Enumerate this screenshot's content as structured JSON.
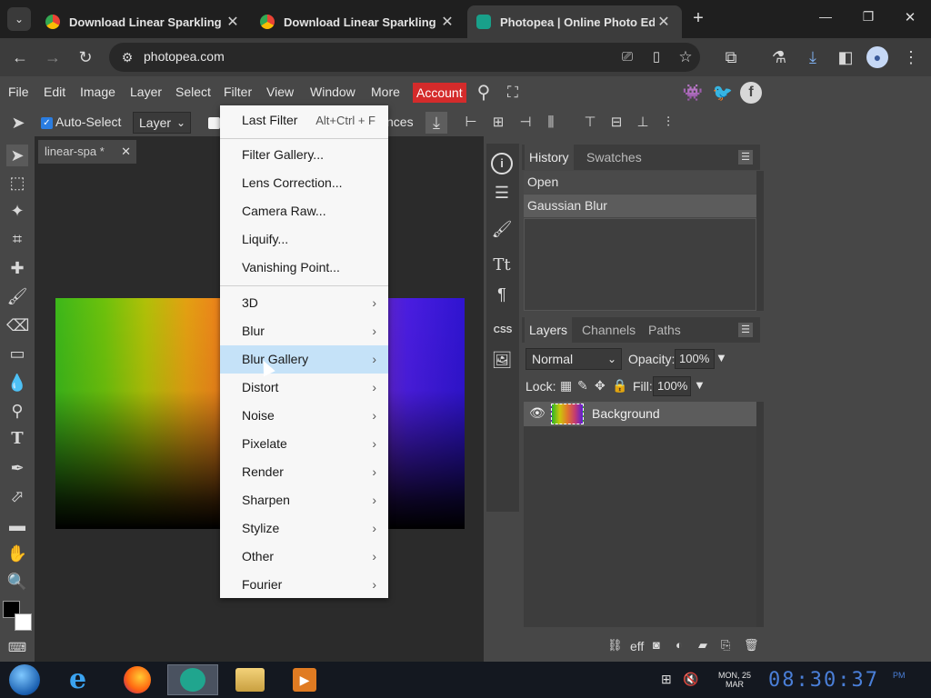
{
  "browser": {
    "tabs": [
      {
        "title": "Download Linear Sparkling Ra",
        "close": "✕"
      },
      {
        "title": "Download Linear Sparkling Ra",
        "close": "✕"
      },
      {
        "title": "Photopea | Online Photo Editor",
        "close": "✕"
      }
    ],
    "new_tab": "+",
    "url": "photopea.com",
    "window_buttons": [
      "—",
      "❐",
      "✕"
    ]
  },
  "menubar": {
    "items": [
      "File",
      "Edit",
      "Image",
      "Layer",
      "Select",
      "Filter",
      "View",
      "Window",
      "More"
    ],
    "account": "Account",
    "account_color": "#d42b2b"
  },
  "options": {
    "auto_select": "Auto-Select",
    "layer_select": "Layer",
    "partial_label": "nces"
  },
  "document": {
    "tab": "linear-spa *",
    "close": "✕"
  },
  "filter_menu": {
    "top": [
      {
        "label": "Last Filter",
        "shortcut": "Alt+Ctrl + F"
      }
    ],
    "group1": [
      "Filter Gallery...",
      "Lens Correction...",
      "Camera Raw...",
      "Liquify...",
      "Vanishing Point..."
    ],
    "group2": [
      "3D",
      "Blur",
      "Blur Gallery",
      "Distort",
      "Noise",
      "Pixelate",
      "Render",
      "Sharpen",
      "Stylize",
      "Other",
      "Fourier"
    ],
    "highlighted": "Blur Gallery",
    "submenu_arrow": "›"
  },
  "history_panel": {
    "tabs": [
      "History",
      "Swatches"
    ],
    "items": [
      "Open",
      "Gaussian Blur"
    ]
  },
  "layers_panel": {
    "tabs": [
      "Layers",
      "Channels",
      "Paths"
    ],
    "blend_mode": "Normal",
    "opacity_label": "Opacity:",
    "opacity_value": "100%",
    "lock_label": "Lock:",
    "fill_label": "Fill:",
    "fill_value": "100%",
    "layers": [
      {
        "name": "Background"
      }
    ],
    "footer_eff": "eff"
  },
  "mid_panel": {
    "css_label": "CSS"
  },
  "taskbar": {
    "date_line1": "MON, 25",
    "date_line2": "MAR",
    "clock": "08:30:37",
    "ampm": "PM"
  }
}
